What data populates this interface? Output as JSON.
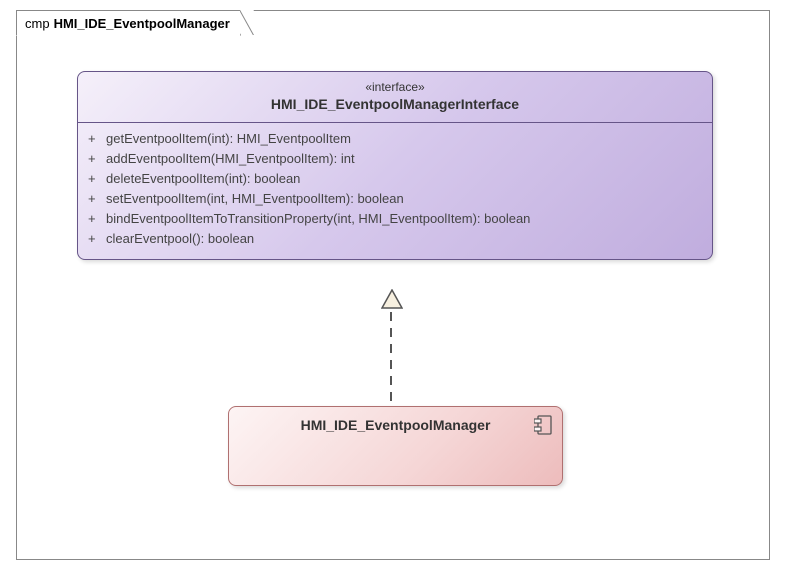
{
  "frame": {
    "prefix": "cmp",
    "title": "HMI_IDE_EventpoolManager"
  },
  "interface": {
    "stereotype": "«interface»",
    "name": "HMI_IDE_EventpoolManagerInterface",
    "methods": [
      {
        "visibility": "+",
        "signature": "getEventpoolItem(int): HMI_EventpoolItem"
      },
      {
        "visibility": "+",
        "signature": "addEventpoolItem(HMI_EventpoolItem): int"
      },
      {
        "visibility": "+",
        "signature": "deleteEventpoolItem(int): boolean"
      },
      {
        "visibility": "+",
        "signature": "setEventpoolItem(int, HMI_EventpoolItem): boolean"
      },
      {
        "visibility": "+",
        "signature": "bindEventpoolItemToTransitionProperty(int, HMI_EventpoolItem): boolean"
      },
      {
        "visibility": "+",
        "signature": "clearEventpool(): boolean"
      }
    ]
  },
  "component": {
    "name": "HMI_IDE_EventpoolManager"
  }
}
